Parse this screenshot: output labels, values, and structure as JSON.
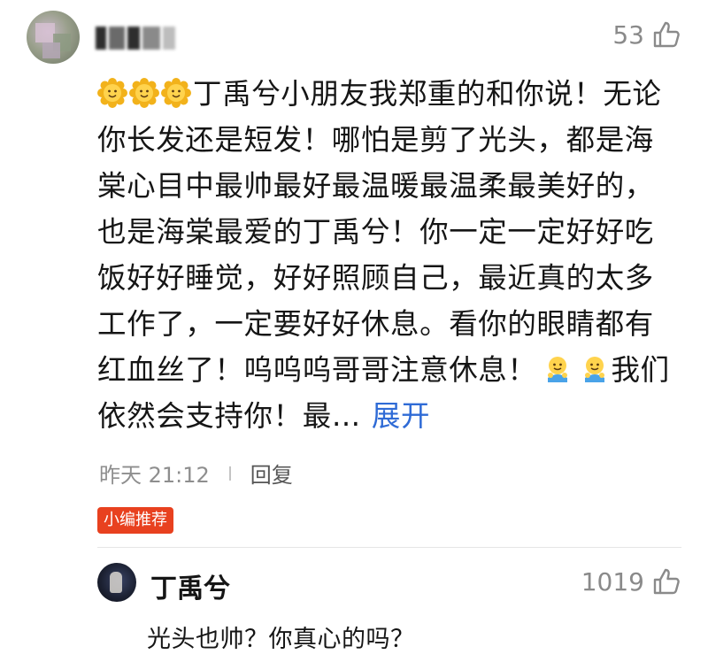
{
  "comment": {
    "likes": "53",
    "text_before": "丁禹兮小朋友我郑重的和你说！无论你长发还是短发！哪怕是剪了光头，都是海棠心目中最帅最好最温暖最温柔最美好的，也是海棠最爱的丁禹兮！你一定一定好好吃饭好好睡觉，好好照顾自己，最近真的太多工作了，一定要好好休息。看你的眼睛都有红血丝了！呜呜呜哥哥注意休息！",
    "text_after": "我们依然会支持你！最…",
    "expand_label": "展开",
    "time": "昨天 21:12",
    "reply_label": "回复",
    "badge": "小编推荐",
    "leading_emoji": "sunflower-emoji",
    "inline_emoji": "hugging-emoji"
  },
  "reply": {
    "name": "丁禹兮",
    "likes": "1019",
    "text": "光头也帅？你真心的吗？"
  },
  "colors": {
    "accent_link": "#2f6bd6",
    "badge_bg": "#e8411f",
    "muted_text": "#8e8e8e"
  }
}
